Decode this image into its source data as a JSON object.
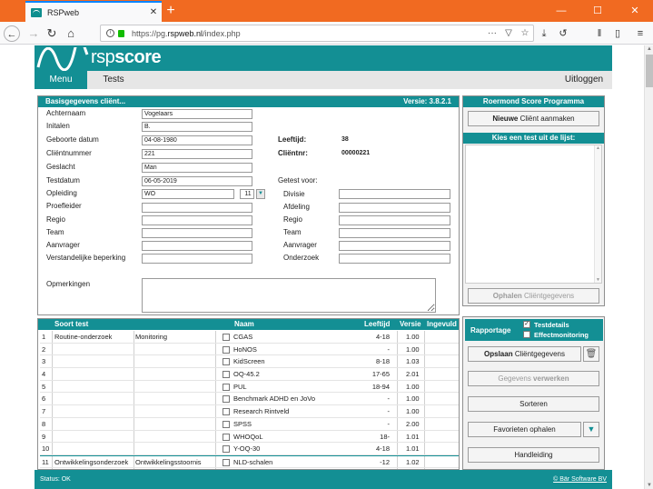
{
  "browser": {
    "tab_title": "RSPweb",
    "url_prefix": "https://pg.",
    "url_domain": "rspweb.nl",
    "url_path": "/index.php"
  },
  "header": {
    "logo_light": "rsp",
    "logo_bold": "score",
    "menu_tab": "Menu",
    "tests_tab": "Tests",
    "logout": "Uitloggen"
  },
  "client": {
    "title": "Basisgegevens cliënt...",
    "version": "Versie: 3.8.2.1",
    "labels": {
      "achternaam": "Achternaam",
      "initialen": "Initalen",
      "geboortedatum": "Geboorte datum",
      "clientnummer": "Cliëntnummer",
      "geslacht": "Geslacht",
      "testdatum": "Testdatum",
      "opleiding": "Opleiding",
      "proefleider": "Proefleider",
      "regio": "Regio",
      "team": "Team",
      "aanvrager": "Aanvrager",
      "beperking": "Verstandelijke beperking",
      "opmerkingen": "Opmerkingen",
      "leeftijd": "Leeftijd:",
      "clientnr": "Cliëntnr:",
      "getest_voor": "Getest voor:",
      "divisie": "Divisie",
      "afdeling": "Afdeling",
      "regio2": "Regio",
      "team2": "Team",
      "aanvrager2": "Aanvrager",
      "onderzoek": "Onderzoek"
    },
    "values": {
      "achternaam": "Vogelaars",
      "initialen": "B.",
      "geboortedatum": "04-08-1980",
      "clientnummer": "221",
      "geslacht": "Man",
      "testdatum": "06-05-2019",
      "opleiding": "WO",
      "opleiding_code": "11",
      "leeftijd": "38",
      "clientnr": "00000221"
    }
  },
  "right_panel": {
    "title": "Roermond Score Programma",
    "new_client_bold": "Nieuwe",
    "new_client_rest": " Cliënt aanmaken",
    "list_title": "Kies een test uit de lijst:",
    "fetch_bold": "Ophalen",
    "fetch_rest": " Cliëntgegevens"
  },
  "tests": {
    "headers": {
      "soort": "Soort test",
      "naam": "Naam",
      "leeftijd": "Leeftijd",
      "versie": "Versie",
      "ingevuld": "Ingevuld"
    },
    "rows": [
      {
        "nr": "1",
        "soort": "Routine-onderzoek",
        "sub": "Monitoring",
        "naam": "CGAS",
        "leeftijd": "4-18",
        "versie": "1.00"
      },
      {
        "nr": "2",
        "soort": "",
        "sub": "",
        "naam": "HoNOS",
        "leeftijd": "-",
        "versie": "1.00"
      },
      {
        "nr": "3",
        "soort": "",
        "sub": "",
        "naam": "KidScreen",
        "leeftijd": "8-18",
        "versie": "1.03"
      },
      {
        "nr": "4",
        "soort": "",
        "sub": "",
        "naam": "OQ-45.2",
        "leeftijd": "17-65",
        "versie": "2.01"
      },
      {
        "nr": "5",
        "soort": "",
        "sub": "",
        "naam": "PUL",
        "leeftijd": "18-94",
        "versie": "1.00"
      },
      {
        "nr": "6",
        "soort": "",
        "sub": "",
        "naam": "Benchmark ADHD en JoVo",
        "leeftijd": "-",
        "versie": "1.00"
      },
      {
        "nr": "7",
        "soort": "",
        "sub": "",
        "naam": "Research Rintveld",
        "leeftijd": "-",
        "versie": "1.00"
      },
      {
        "nr": "8",
        "soort": "",
        "sub": "",
        "naam": "SPSS",
        "leeftijd": "-",
        "versie": "2.00"
      },
      {
        "nr": "9",
        "soort": "",
        "sub": "",
        "naam": "WHOQoL",
        "leeftijd": "18-",
        "versie": "1.01"
      },
      {
        "nr": "10",
        "soort": "",
        "sub": "",
        "naam": "Y-OQ-30",
        "leeftijd": "4-18",
        "versie": "1.01"
      },
      {
        "nr": "11",
        "soort": "Ontwikkelingsonderzoek",
        "sub": "Ontwikkelingsstoornis",
        "naam": "NLD-schalen",
        "leeftijd": "-12",
        "versie": "1.02"
      }
    ]
  },
  "actions": {
    "rapportage": "Rapportage",
    "testdetails": "Testdetails",
    "effectmonitoring": "Effectmonitoring",
    "save_bold": "Opslaan",
    "save_rest": " Cliëntgegevens",
    "process_light": "Gegevens ",
    "process_bold": "verwerken",
    "sort": "Sorteren",
    "favorites": "Favorieten ophalen",
    "manual": "Handleiding"
  },
  "status": {
    "text": "Status: OK",
    "copyright": "© Bär Software BV"
  }
}
